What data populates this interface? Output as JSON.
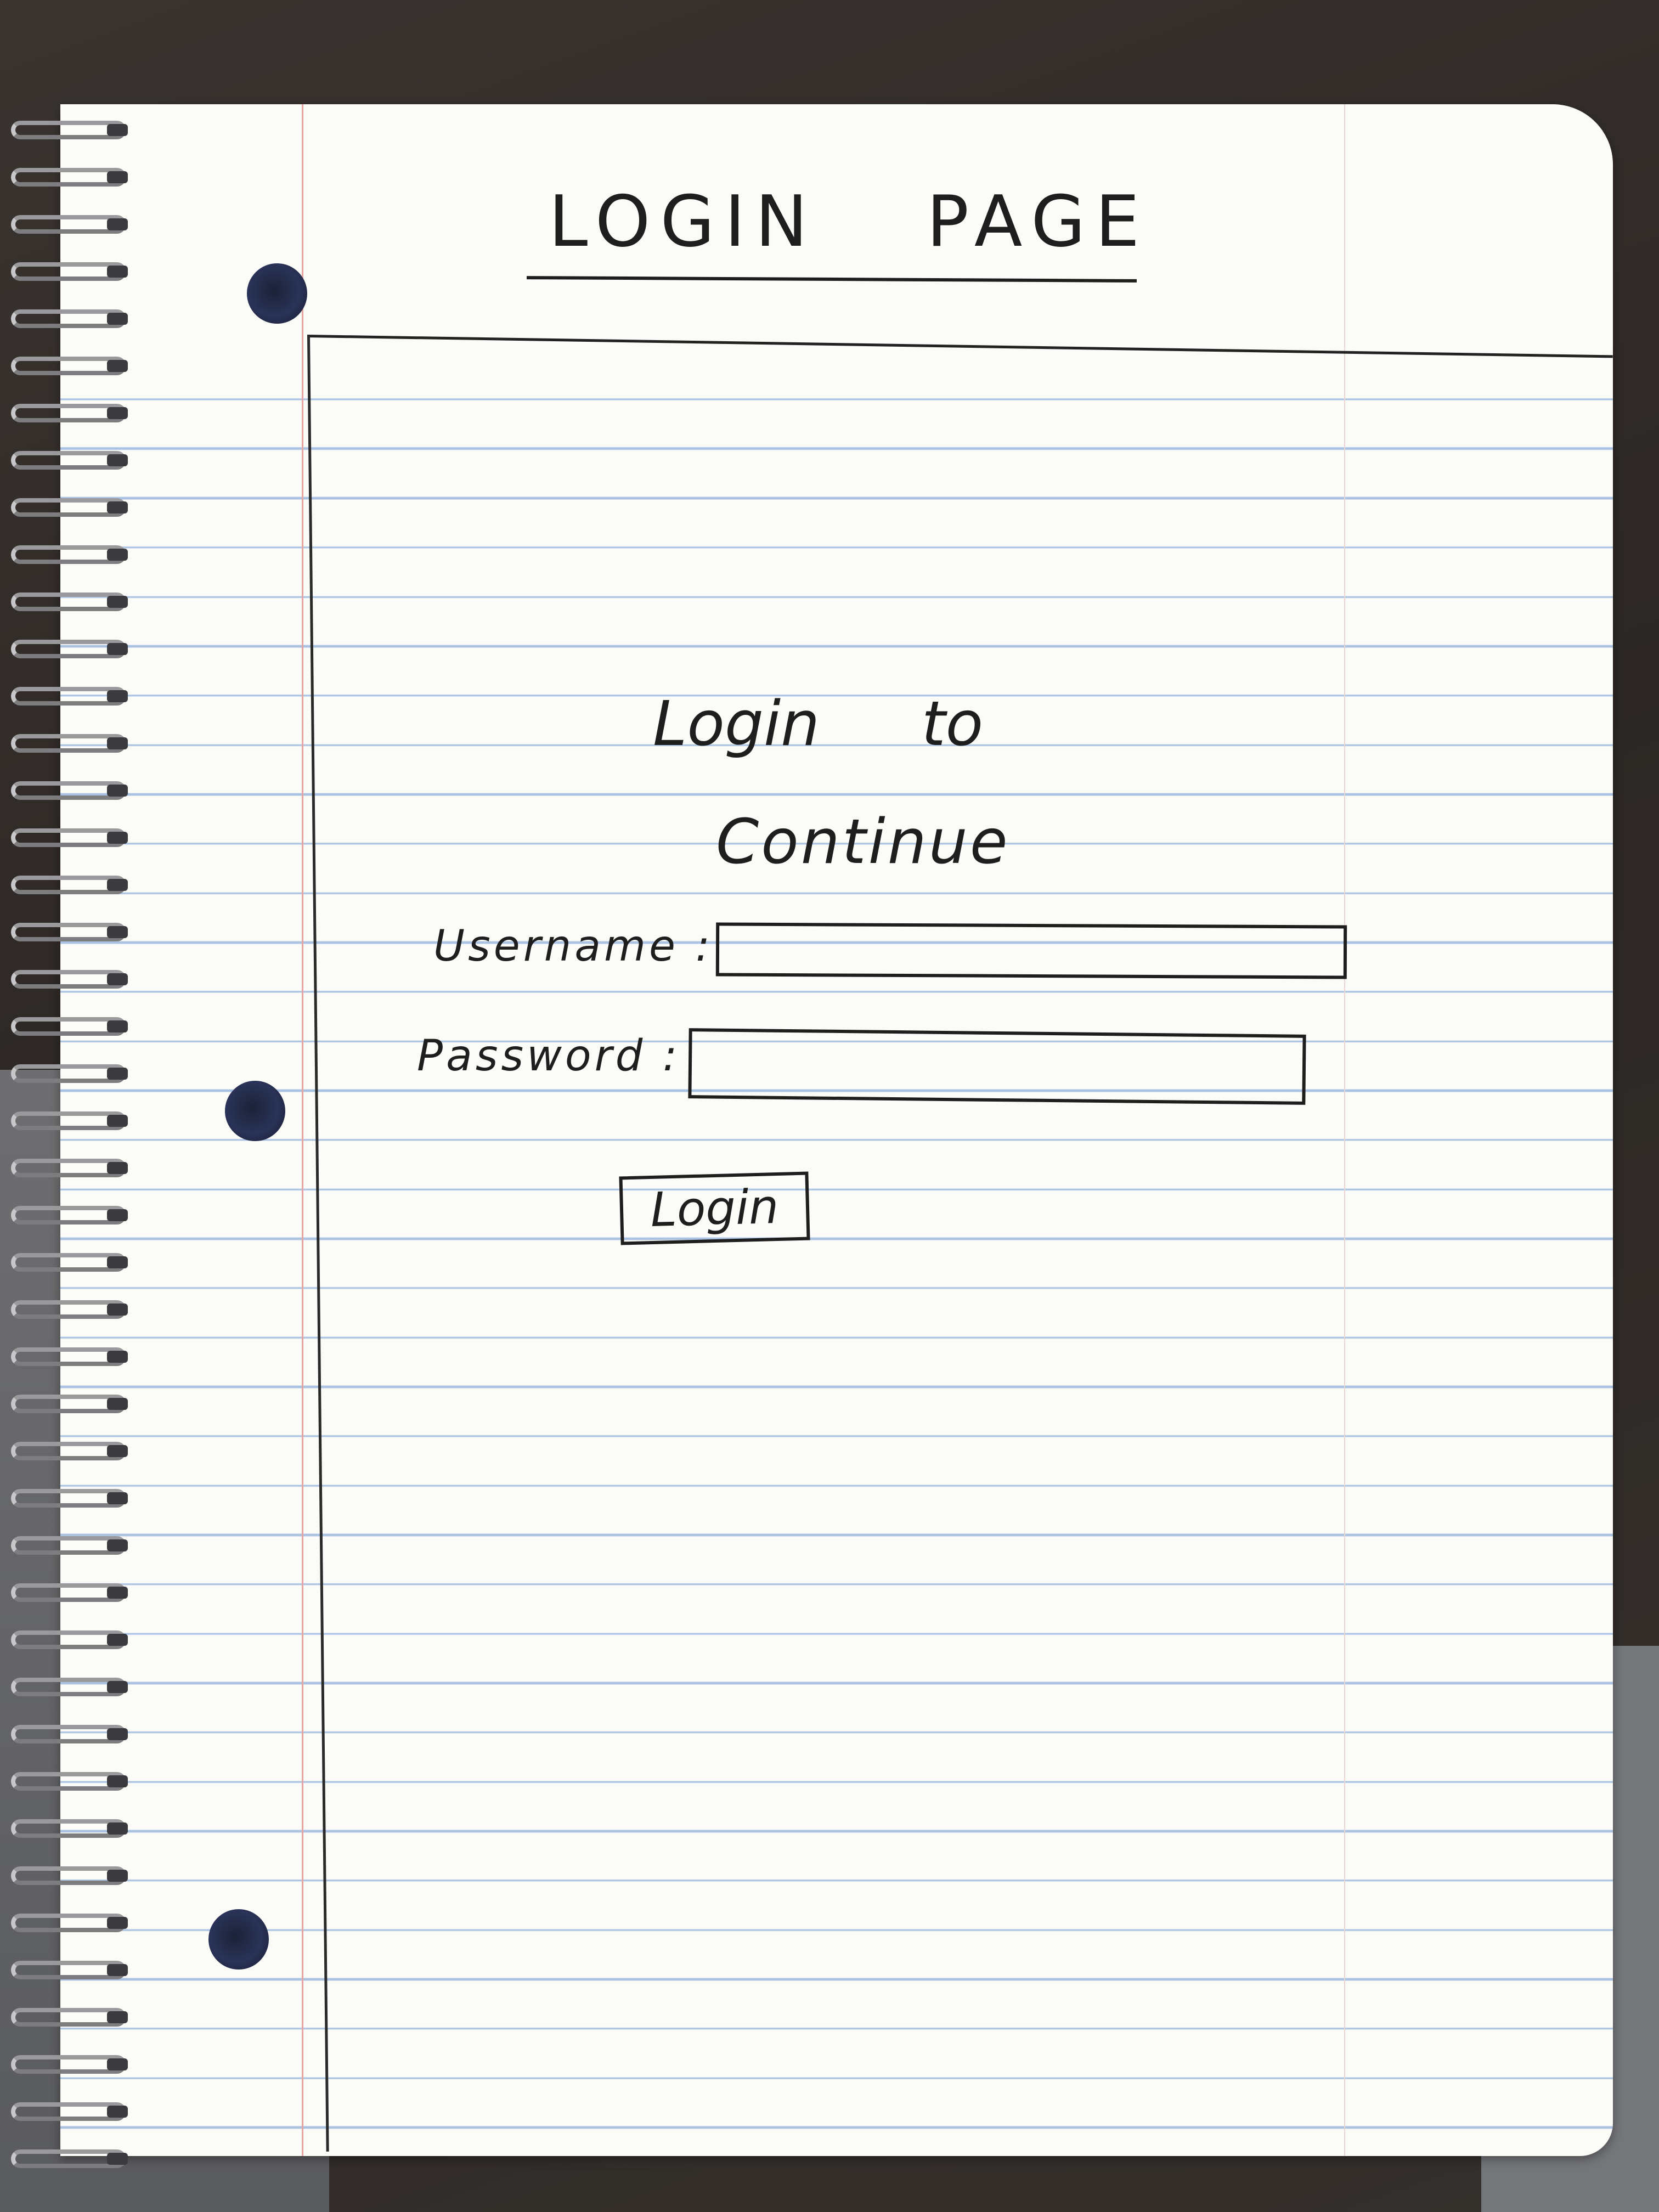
{
  "page": {
    "title": "LOGIN PAGE",
    "heading_line1": "Login to",
    "heading_line2": "Continue"
  },
  "form": {
    "username_label": "Username :",
    "username_value": "",
    "password_label": "Password :",
    "password_value": "",
    "login_button": "Login"
  }
}
